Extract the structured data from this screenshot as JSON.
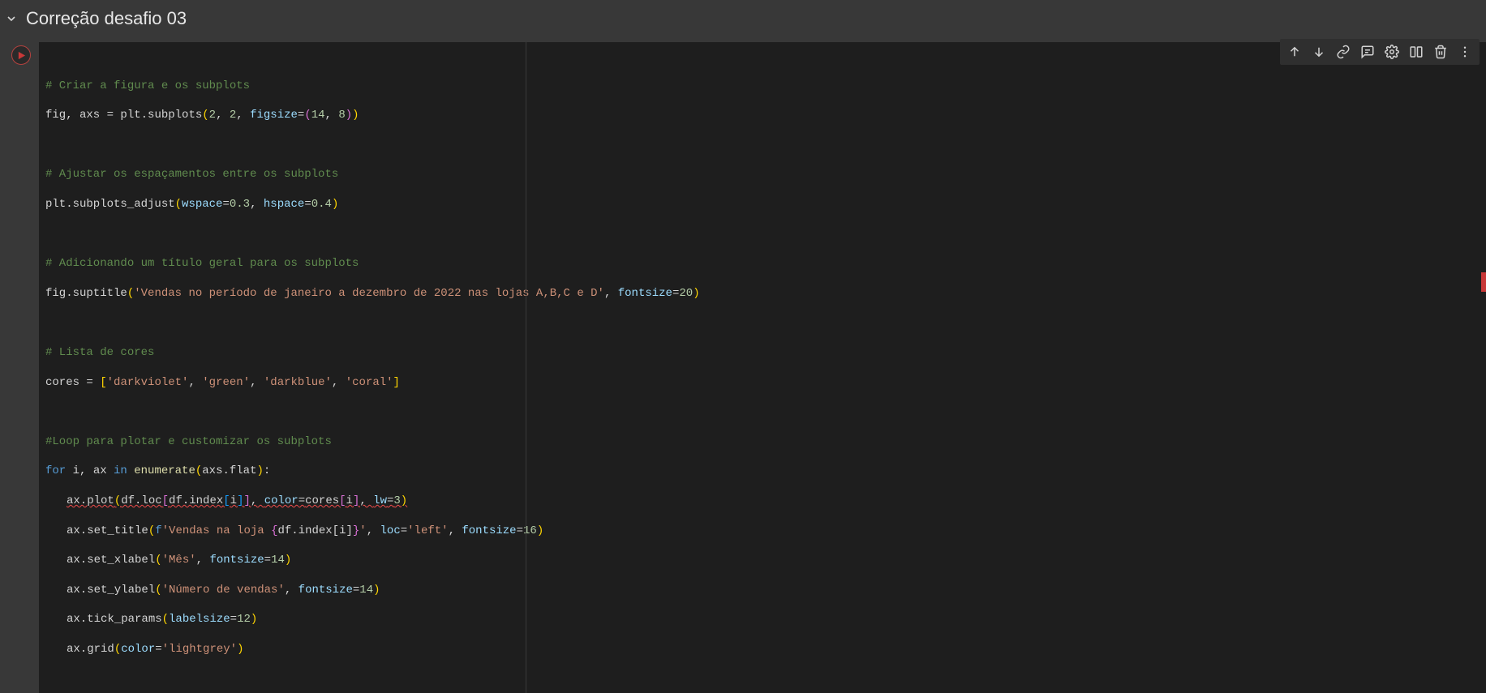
{
  "header": {
    "title": "Correção desafio 03"
  },
  "toolbar": {
    "move_up": "Move cell up",
    "move_down": "Move cell down",
    "link": "Link",
    "comment": "Add comment",
    "settings": "Open settings",
    "mirror": "Mirror cell",
    "delete": "Delete cell",
    "more": "More actions"
  },
  "code": {
    "c1": "# Criar a figura e os subplots",
    "l2_a": "fig, axs ",
    "l2_b": " plt.subplots",
    "l2_n1": "2",
    "l2_n2": "2",
    "l2_kw": "figsize",
    "l2_n3": "14",
    "l2_n4": "8",
    "c3": "# Ajustar os espaçamentos entre os subplots",
    "l4_a": "plt.subplots_adjust",
    "l4_kw1": "wspace",
    "l4_v1": "0.3",
    "l4_kw2": "hspace",
    "l4_v2": "0.4",
    "c5": "# Adicionando um título geral para os subplots",
    "l6_a": "fig.suptitle",
    "l6_s": "'Vendas no período de janeiro a dezembro de 2022 nas lojas A,B,C e D'",
    "l6_kw": "fontsize",
    "l6_v": "20",
    "c7": "# Lista de cores",
    "l8_a": "cores ",
    "l8_s1": "'darkviolet'",
    "l8_s2": "'green'",
    "l8_s3": "'darkblue'",
    "l8_s4": "'coral'",
    "c9": "#Loop para plotar e customizar os subplots",
    "l10_for": "for",
    "l10_vars": " i, ax ",
    "l10_in": "in",
    "l10_enum": " enumerate",
    "l10_arg": "axs.flat",
    "l11_a": "ax.plot",
    "l11_b": "df.loc",
    "l11_c": "df.index",
    "l11_i": "i",
    "l11_kw1": "color",
    "l11_cores": "cores",
    "l11_kw2": "lw",
    "l11_v2": "3",
    "l12_a": "ax.set_title",
    "l12_f": "f",
    "l12_s1": "'Vendas na loja ",
    "l12_expr": "df.index[i]",
    "l12_s2": "'",
    "l12_kw1": "loc",
    "l12_v1": "'left'",
    "l12_kw2": "fontsize",
    "l12_v2": "16",
    "l13_a": "ax.set_xlabel",
    "l13_s": "'Mês'",
    "l13_kw": "fontsize",
    "l13_v": "14",
    "l14_a": "ax.set_ylabel",
    "l14_s": "'Número de vendas'",
    "l14_kw": "fontsize",
    "l14_v": "14",
    "l15_a": "ax.tick_params",
    "l15_kw": "labelsize",
    "l15_v": "12",
    "l16_a": "ax.grid",
    "l16_kw": "color",
    "l16_v": "'lightgrey'"
  }
}
